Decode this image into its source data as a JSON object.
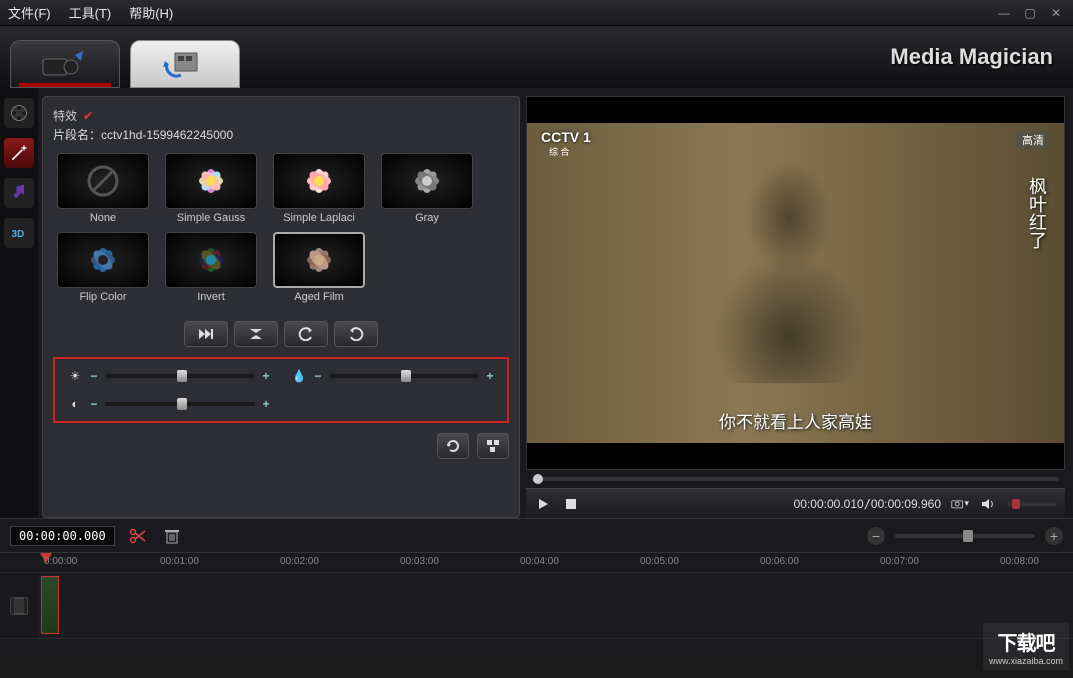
{
  "menu": {
    "file": "文件(F)",
    "tools": "工具(T)",
    "help": "帮助(H)"
  },
  "brand": "Media Magician",
  "panel": {
    "title": "特效",
    "clip_label": "片段名：",
    "clip_name": "cctv1hd-1599462245000"
  },
  "effects": [
    {
      "name": "None"
    },
    {
      "name": "Simple Gauss"
    },
    {
      "name": "Simple Laplaci"
    },
    {
      "name": "Gray"
    },
    {
      "name": "Flip Color"
    },
    {
      "name": "Invert"
    },
    {
      "name": "Aged Film",
      "selected": true
    }
  ],
  "sliders": {
    "brightness": 48,
    "saturation": 48,
    "contrast": 48
  },
  "preview": {
    "channel": "CCTV 1",
    "channel_sub": "综 合",
    "hd": "高清",
    "vertical_title": "枫叶红了",
    "subtitle": "你不就看上人家高娃"
  },
  "player": {
    "current": "00:00:00.010",
    "total": "00:00:09.960"
  },
  "timeline": {
    "cursor": "00:00:00.000",
    "marks": [
      "0:00:00",
      "00:01:00",
      "00:02:00",
      "00:03:00",
      "00:04:00",
      "00:05:00",
      "00:06:00",
      "00:07:00",
      "00:08:00"
    ]
  },
  "watermark": {
    "logo": "下载吧",
    "url": "www.xiazaiba.com"
  }
}
